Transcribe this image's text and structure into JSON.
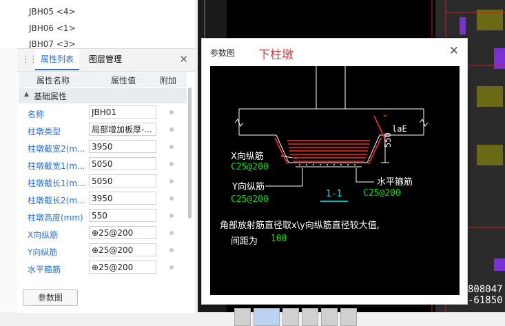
{
  "component_list": {
    "items": [
      "JBH05 <4>",
      "JBH06 <1>",
      "JBH07 <3>"
    ]
  },
  "property_panel": {
    "tabs": [
      "属性列表",
      "图层管理"
    ],
    "columns": [
      "属性名称",
      "属性值",
      "附加"
    ],
    "group": "基础属性",
    "rows": [
      {
        "name": "名称",
        "value": "JBH01"
      },
      {
        "name": "柱墩类型",
        "value": "局部增加板厚-..."
      },
      {
        "name": "柱墩截宽2(m...",
        "value": "3950"
      },
      {
        "name": "柱墩截宽1(m...",
        "value": "5050"
      },
      {
        "name": "柱墩截长1(m...",
        "value": "5050"
      },
      {
        "name": "柱墩截长2(m...",
        "value": "3950"
      },
      {
        "name": "柱墩高度(mm)",
        "value": "550"
      },
      {
        "name": "X向纵筋",
        "value": "⊕25@200"
      },
      {
        "name": "Y向纵筋",
        "value": "⊕25@200"
      },
      {
        "name": "水平箍筋",
        "value": "⊕25@200"
      }
    ],
    "param_button": "参数图"
  },
  "dialog": {
    "title": "参数图",
    "component_name": "下柱墩",
    "diagram": {
      "la_label": "laE",
      "height_label": "550",
      "x_rebar_label": "X向纵筋",
      "x_rebar_value": "C25@200",
      "y_rebar_label": "Y向纵筋",
      "y_rebar_value": "C25@200",
      "stirrup_label": "水平箍筋",
      "stirrup_value": "C25@200",
      "section_label": "1-1",
      "note_line1": "角部放射筋直径取x\\y向纵筋直径较大值,",
      "note_line2_prefix": "间距为",
      "note_line2_value": "100"
    }
  },
  "cad_background": {
    "readout_1": "808047",
    "readout_2": "-61850"
  },
  "colors": {
    "accent": "#2a6fd6",
    "title_red": "#e03b3b",
    "cad_green": "#00e000",
    "cad_cyan": "#00ffff",
    "rebar_red": "#ff2a2a"
  }
}
